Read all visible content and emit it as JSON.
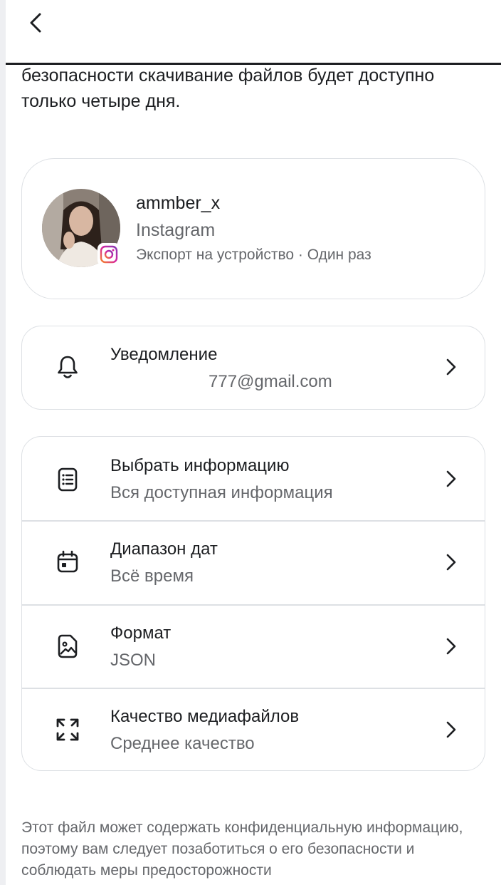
{
  "intro": {
    "text": "безопасности скачивание файлов будет доступно только четыре дня."
  },
  "profile": {
    "username": "ammber_x",
    "platform": "Instagram",
    "export_info": "Экспорт на устройство · Один раз",
    "badge_icon": "instagram-icon"
  },
  "notification": {
    "title": "Уведомление",
    "value": "777@gmail.com",
    "icon": "bell-icon"
  },
  "settings": {
    "rows": [
      {
        "title": "Выбрать информацию",
        "value": "Вся доступная информация",
        "icon": "document-list-icon"
      },
      {
        "title": "Диапазон дат",
        "value": "Всё время",
        "icon": "calendar-icon"
      },
      {
        "title": "Формат",
        "value": "JSON",
        "icon": "file-image-icon"
      },
      {
        "title": "Качество медиафайлов",
        "value": "Среднее качество",
        "icon": "expand-arrows-icon"
      }
    ]
  },
  "footer": {
    "text": "Этот файл может содержать конфиденциальную информацию, поэтому вам следует позаботиться о его безопасности и соблюдать меры предосторожности"
  },
  "colors": {
    "text_primary": "#1c1e21",
    "text_secondary": "#65676b",
    "border": "#dde0e4",
    "instagram_accent": "#d6249f"
  }
}
